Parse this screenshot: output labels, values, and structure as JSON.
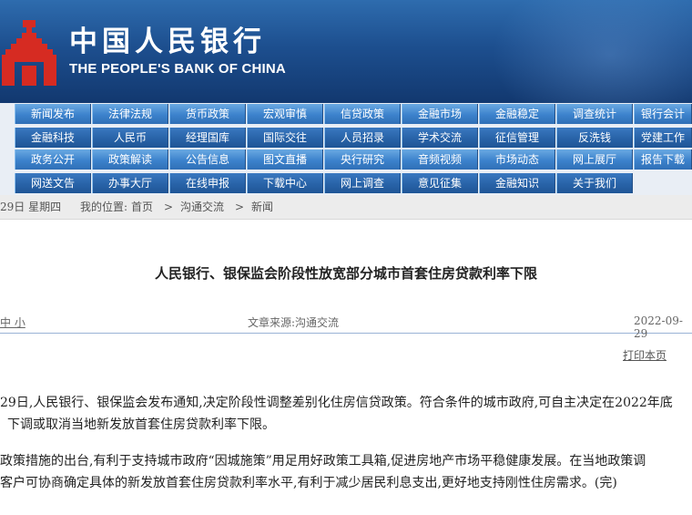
{
  "header": {
    "logo_cn": "中国人民银行",
    "logo_en": "THE PEOPLE'S BANK OF CHINA",
    "colors": {
      "logo_red": "#d62b22",
      "header_blue": "#1d4f8f",
      "nav_blue": "#3c82cc"
    }
  },
  "nav": {
    "rows": [
      [
        "新闻发布",
        "法律法规",
        "货币政策",
        "宏观审慎",
        "信贷政策",
        "金融市场",
        "金融稳定",
        "调查统计",
        "银行会计"
      ],
      [
        "金融科技",
        "人民币",
        "经理国库",
        "国际交往",
        "人员招录",
        "学术交流",
        "征信管理",
        "反洗钱",
        "党建工作"
      ],
      [
        "政务公开",
        "政策解读",
        "公告信息",
        "图文直播",
        "央行研究",
        "音频视频",
        "市场动态",
        "网上展厅",
        "报告下载"
      ],
      [
        "网送文告",
        "办事大厅",
        "在线申报",
        "下载中心",
        "网上调查",
        "意见征集",
        "金融知识",
        "关于我们"
      ]
    ]
  },
  "breadcrumb": {
    "date": "29日 星期四",
    "location_label": "我的位置:",
    "home": "首页",
    "sep1": ">",
    "section": "沟通交流",
    "sep2": ">",
    "current": "新闻"
  },
  "article": {
    "title": "人民银行、银保监会阶段性放宽部分城市首套住房贷款利率下限",
    "font_size_links": "中 小",
    "source": "文章来源:沟通交流",
    "date": "2022-09-29",
    "print": "打印本页",
    "p1_line1": "29日,人民银行、银保监会发布通知,决定阶段性调整差别化住房信贷政策。符合条件的城市政府,可自主决定在2022年底",
    "p1_line2": "下调或取消当地新发放首套住房贷款利率下限。",
    "p2_line1": "政策措施的出台,有利于支持城市政府“因城施策”用足用好政策工具箱,促进房地产市场平稳健康发展。在当地政策调",
    "p2_line2": "客户可协商确定具体的新发放首套住房贷款利率水平,有利于减少居民利息支出,更好地支持刚性住房需求。(完)"
  }
}
